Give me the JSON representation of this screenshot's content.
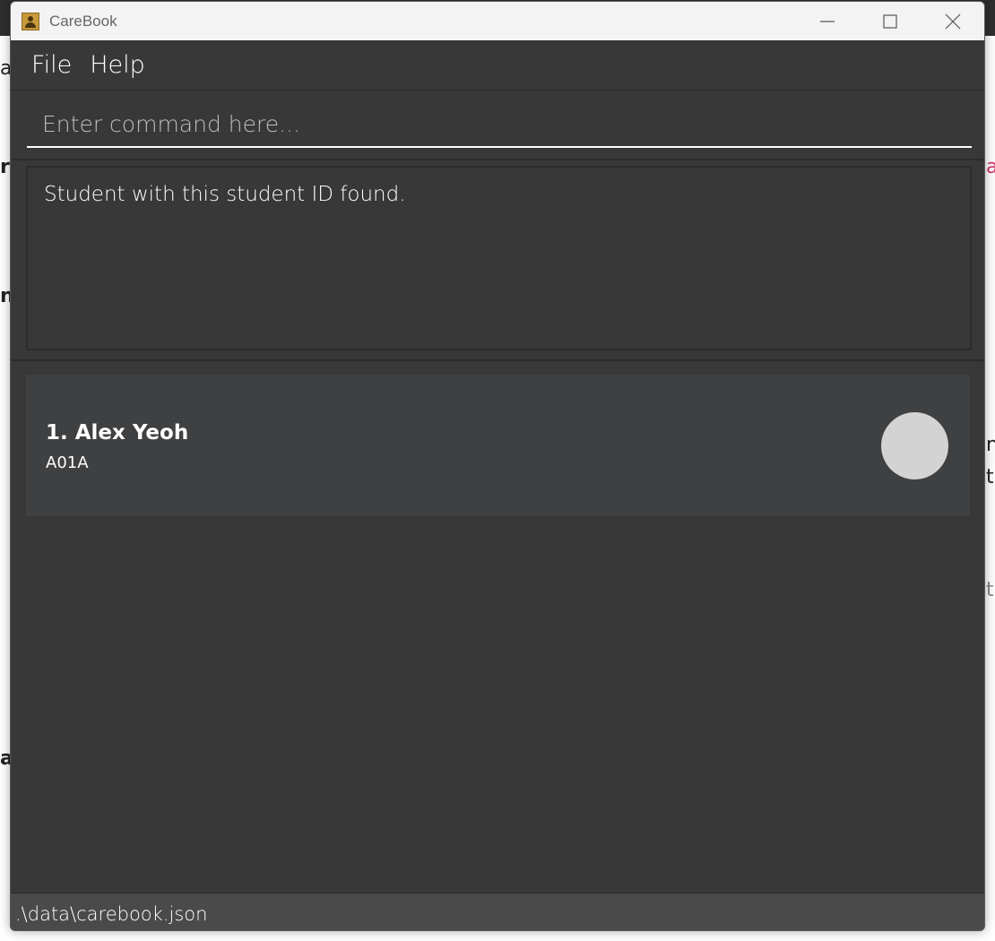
{
  "window": {
    "title": "CareBook"
  },
  "menu": {
    "items": [
      {
        "label": "File"
      },
      {
        "label": "Help"
      }
    ]
  },
  "command": {
    "value": "",
    "placeholder": "Enter command here..."
  },
  "result": {
    "message": "Student with this student ID found."
  },
  "persons": [
    {
      "index_name": "1. Alex Yeoh",
      "student_id": "A01A"
    }
  ],
  "status": {
    "file_path": ".\\data\\carebook.json"
  },
  "background_fragments": [
    "a",
    "r",
    "n",
    "a",
    "a",
    "n",
    "tu",
    "t"
  ],
  "colors": {
    "window_bg": "#383838",
    "card_bg": "#3f4042",
    "avatar": "#d3d3d3",
    "text": "#ffffff"
  },
  "icons": {
    "app": "contact-book-icon",
    "minimize": "minimize-icon",
    "maximize": "maximize-icon",
    "close": "close-icon"
  }
}
